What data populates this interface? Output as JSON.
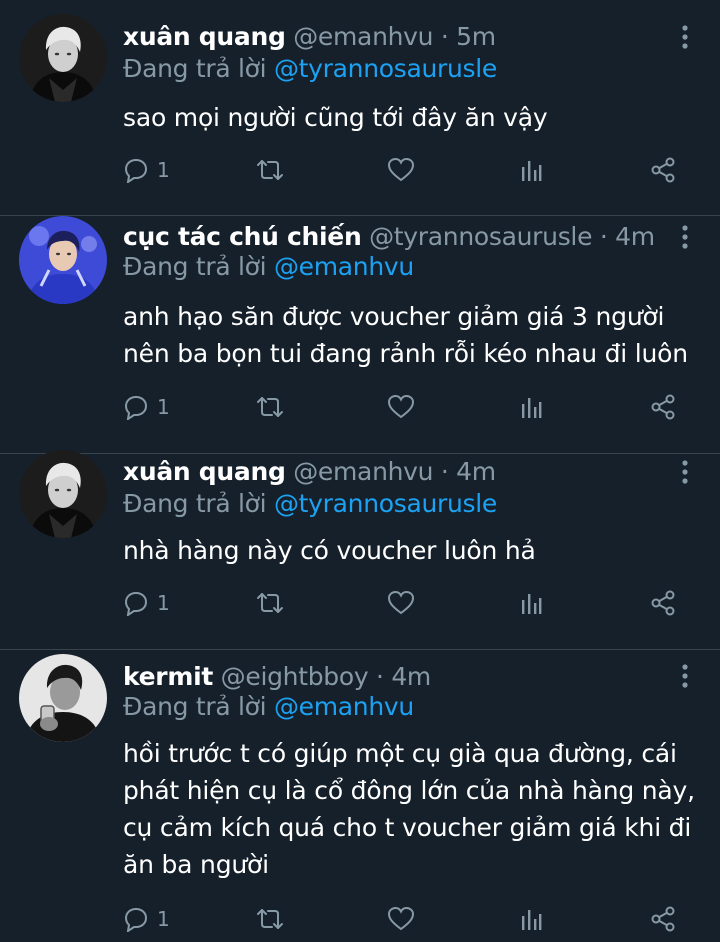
{
  "tweets": [
    {
      "name": "xuân quang",
      "handle": "@emanhvu",
      "separator": "·",
      "time": "5m",
      "replying_prefix": "Đang trả lời",
      "replying_to": "@tyrannosaurusle",
      "body": "sao mọi người cũng tới đây ăn vậy",
      "reply_count": "1",
      "avatar_icon": "dark-avatar-photo"
    },
    {
      "name": "cục tác chú chiến",
      "handle": "@tyrannosaurusle",
      "separator": "·",
      "time": "4m",
      "replying_prefix": "Đang trả lời",
      "replying_to": "@emanhvu",
      "body": "anh hạo săn được voucher giảm giá 3 người nên ba bọn tui đang rảnh rỗi kéo nhau đi luôn",
      "reply_count": "1",
      "avatar_icon": "blue-avatar-photo"
    },
    {
      "name": "xuân quang",
      "handle": "@emanhvu",
      "separator": "·",
      "time": "4m",
      "replying_prefix": "Đang trả lời",
      "replying_to": "@tyrannosaurusle",
      "body": "nhà hàng này có voucher luôn hả",
      "reply_count": "1",
      "avatar_icon": "dark-avatar-photo"
    },
    {
      "name": "kermit",
      "handle": "@eightbboy",
      "separator": "·",
      "time": "4m",
      "replying_prefix": "Đang trả lời",
      "replying_to": "@emanhvu",
      "body": "hồi trước t có giúp một cụ già qua đường, cái phát hiện cụ là cổ đông lớn của nhà hàng này, cụ cảm kích quá cho t voucher giảm giá khi đi ăn ba người",
      "reply_count": "1",
      "avatar_icon": "grayscale-avatar-photo"
    }
  ],
  "colors": {
    "background": "#15202b",
    "secondary_text": "#8899a6",
    "mention": "#1da1f2",
    "divider": "#38444d"
  }
}
